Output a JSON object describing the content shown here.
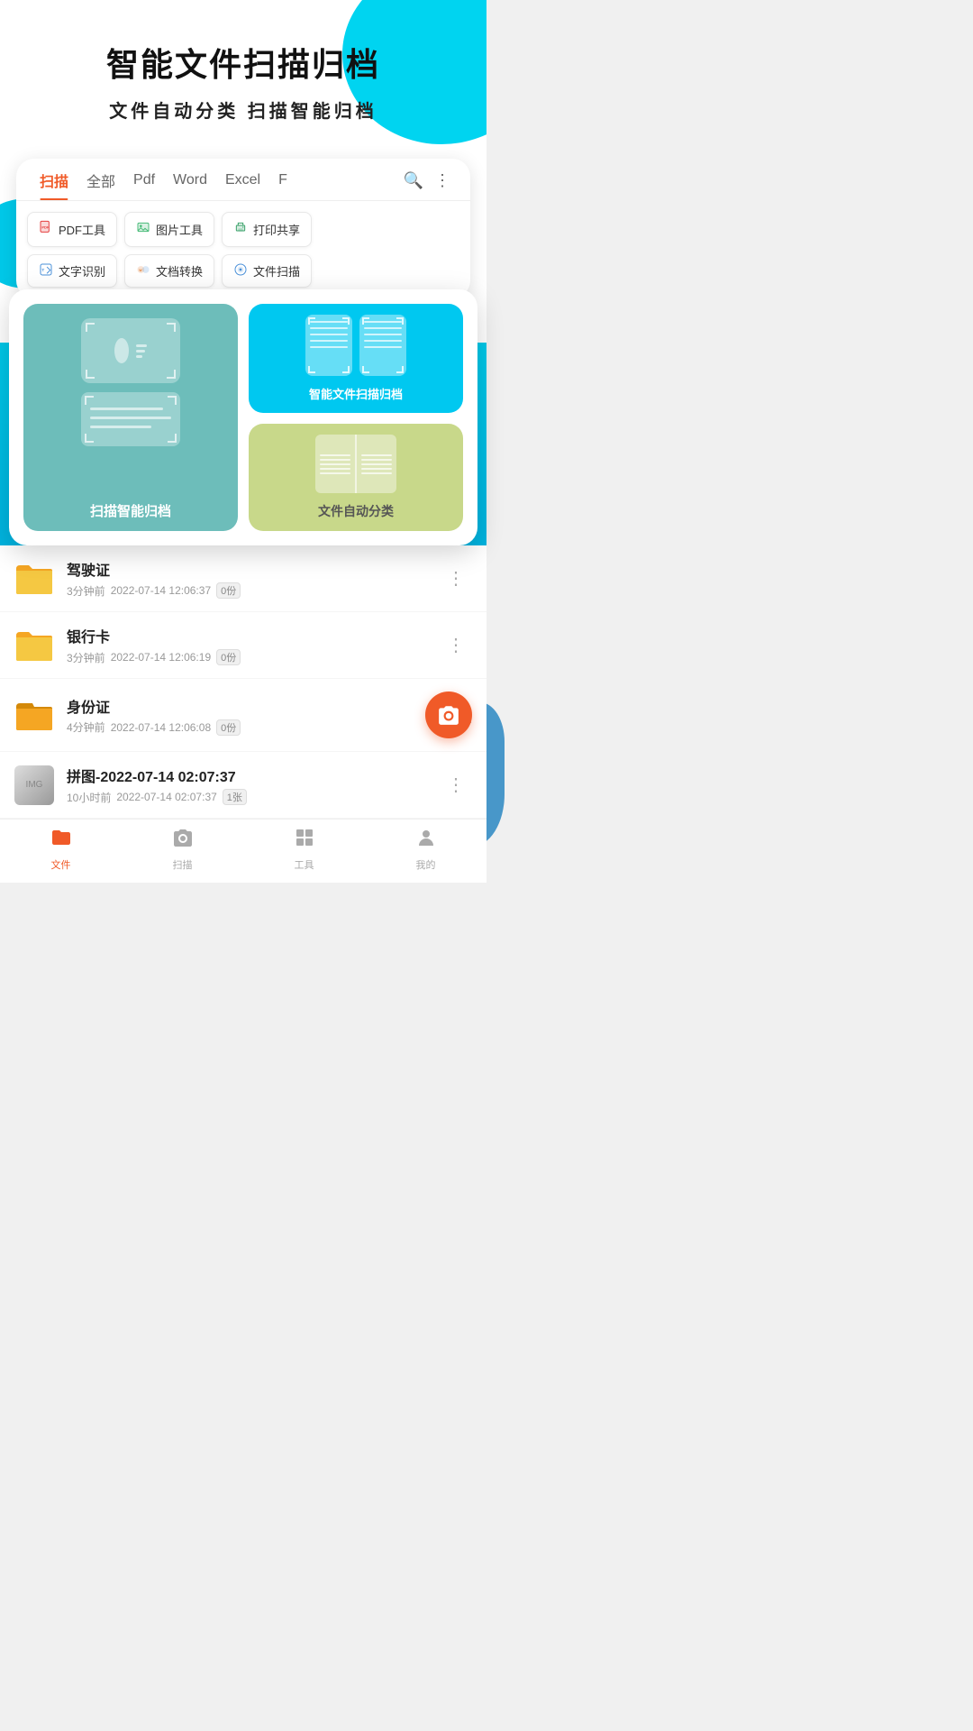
{
  "header": {
    "title": "智能文件扫描归档",
    "subtitle": "文件自动分类   扫描智能归档"
  },
  "tabs": {
    "items": [
      {
        "label": "扫描",
        "active": true
      },
      {
        "label": "全部",
        "active": false
      },
      {
        "label": "Pdf",
        "active": false
      },
      {
        "label": "Word",
        "active": false
      },
      {
        "label": "Excel",
        "active": false
      },
      {
        "label": "F",
        "active": false
      }
    ]
  },
  "tools": {
    "row1": [
      {
        "label": "PDF工具",
        "icon": "pdf"
      },
      {
        "label": "图片工具",
        "icon": "image"
      },
      {
        "label": "打印共享",
        "icon": "print"
      }
    ],
    "row2": [
      {
        "label": "文字识别",
        "icon": "text"
      },
      {
        "label": "文档转换",
        "icon": "convert"
      },
      {
        "label": "文件扫描",
        "icon": "scan"
      }
    ]
  },
  "popup": {
    "left_label": "扫描智能归档",
    "right_top_label": "智能文件扫描归档",
    "right_bottom_label": "文件自动分类"
  },
  "files": [
    {
      "name": "驾驶证",
      "time": "3分钟前",
      "date": "2022-07-14 12:06:37",
      "count": "0份",
      "type": "folder"
    },
    {
      "name": "银行卡",
      "time": "3分钟前",
      "date": "2022-07-14 12:06:19",
      "count": "0份",
      "type": "folder"
    },
    {
      "name": "身份证",
      "time": "4分钟前",
      "date": "2022-07-14 12:06:08",
      "count": "0份",
      "type": "folder"
    },
    {
      "name": "拼图-2022-07-14 02:07:37",
      "time": "10小时前",
      "date": "2022-07-14 02:07:37",
      "count": "1张",
      "type": "image"
    }
  ],
  "bottomNav": {
    "items": [
      {
        "label": "文件",
        "icon": "folder",
        "active": true
      },
      {
        "label": "扫描",
        "icon": "camera",
        "active": false
      },
      {
        "label": "工具",
        "icon": "grid",
        "active": false
      },
      {
        "label": "我的",
        "icon": "person",
        "active": false
      }
    ]
  }
}
